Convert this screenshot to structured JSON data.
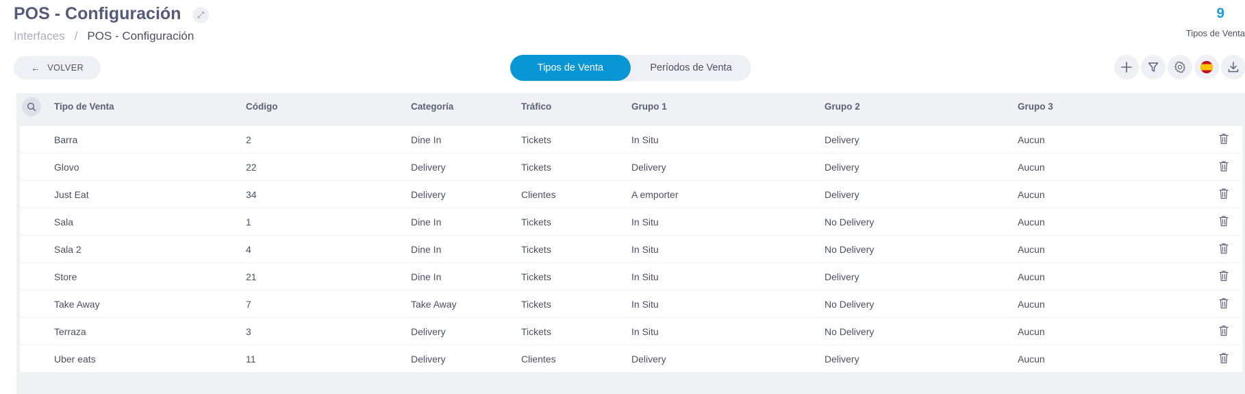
{
  "header": {
    "title": "POS - Configuración",
    "expand_glyph": "⤢",
    "breadcrumb": {
      "root": "Interfaces",
      "separator": "/",
      "current": "POS - Configuración"
    },
    "counter": {
      "value": "9",
      "label": "Tipos de Venta"
    }
  },
  "toolbar": {
    "back_arrow": "←",
    "back_label": "VOLVER",
    "tabs": [
      {
        "label": "Tipos de Venta",
        "active": true
      },
      {
        "label": "Períodos de Venta",
        "active": false
      }
    ],
    "actions": [
      "plus-icon",
      "filter-icon",
      "gear-icon",
      "spain-flag-icon",
      "download-icon"
    ]
  },
  "table": {
    "columns": [
      "Tipo de Venta",
      "Código",
      "Categoría",
      "Tráfico",
      "Grupo 1",
      "Grupo 2",
      "Grupo 3"
    ],
    "rows": [
      [
        "Barra",
        "2",
        "Dine In",
        "Tickets",
        "In Situ",
        "Delivery",
        "Aucun"
      ],
      [
        "Glovo",
        "22",
        "Delivery",
        "Tickets",
        "Delivery",
        "Delivery",
        "Aucun"
      ],
      [
        "Just Eat",
        "34",
        "Delivery",
        "Clientes",
        "A emporter",
        "Delivery",
        "Aucun"
      ],
      [
        "Sala",
        "1",
        "Dine In",
        "Tickets",
        "In Situ",
        "No Delivery",
        "Aucun"
      ],
      [
        "Sala 2",
        "4",
        "Dine In",
        "Tickets",
        "In Situ",
        "No Delivery",
        "Aucun"
      ],
      [
        "Store",
        "21",
        "Dine In",
        "Tickets",
        "In Situ",
        "Delivery",
        "Aucun"
      ],
      [
        "Take Away",
        "7",
        "Take Away",
        "Tickets",
        "In Situ",
        "No Delivery",
        "Aucun"
      ],
      [
        "Terraza",
        "3",
        "Delivery",
        "Tickets",
        "In Situ",
        "No Delivery",
        "Aucun"
      ],
      [
        "Uber eats",
        "11",
        "Delivery",
        "Clientes",
        "Delivery",
        "Delivery",
        "Aucun"
      ]
    ]
  },
  "colors": {
    "accent": "#0996d4",
    "counter": "#1a9cd8",
    "flag_red": "#c60b1e",
    "flag_yellow": "#ffc400"
  }
}
